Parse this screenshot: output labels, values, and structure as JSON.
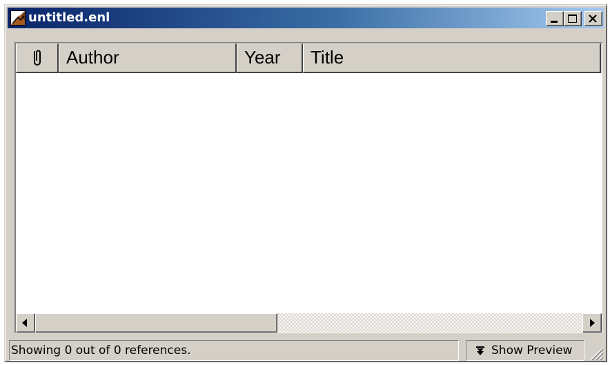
{
  "window": {
    "title": "untitled.enl",
    "titlebar_colors": {
      "start": "#0a246a",
      "end": "#a6caf0"
    }
  },
  "caption_buttons": [
    "minimize-icon",
    "maximize-icon",
    "close-icon"
  ],
  "columns": [
    {
      "label": "",
      "icon": "paperclip-icon"
    },
    {
      "label": "Author"
    },
    {
      "label": "Year"
    },
    {
      "label": "Title"
    }
  ],
  "references": [],
  "status": {
    "text": "Showing 0 out of 0 references.",
    "preview_label": "Show Preview",
    "preview_icon": "double-chevron-down-icon"
  }
}
